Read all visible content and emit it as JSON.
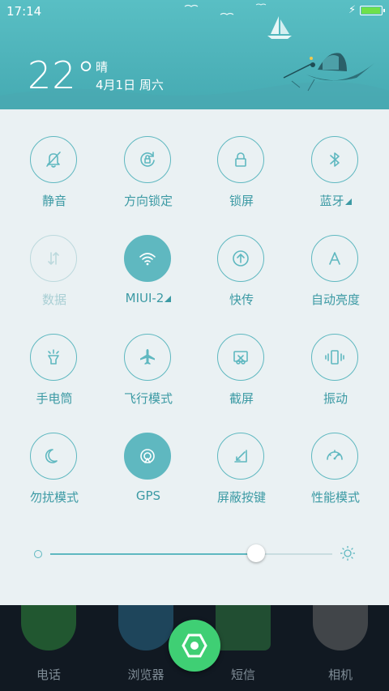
{
  "status_bar": {
    "time": "17:14",
    "battery_level": 1.0
  },
  "weather": {
    "temperature": "22°",
    "condition": "晴",
    "date": "4月1日 周六"
  },
  "toggles": [
    {
      "label": "静音",
      "icon": "bell-off-icon",
      "state": "off"
    },
    {
      "label": "方向锁定",
      "icon": "rotation-lock-icon",
      "state": "off"
    },
    {
      "label": "锁屏",
      "icon": "lock-icon",
      "state": "off"
    },
    {
      "label": "蓝牙",
      "icon": "bluetooth-icon",
      "state": "off",
      "has_submenu": true
    },
    {
      "label": "数据",
      "icon": "data-arrows-icon",
      "state": "disabled"
    },
    {
      "label": "MIUI-2",
      "icon": "wifi-icon",
      "state": "on",
      "has_submenu": true
    },
    {
      "label": "快传",
      "icon": "upload-icon",
      "state": "off"
    },
    {
      "label": "自动亮度",
      "icon": "auto-brightness-icon",
      "state": "off"
    },
    {
      "label": "手电筒",
      "icon": "flashlight-icon",
      "state": "off"
    },
    {
      "label": "飞行模式",
      "icon": "airplane-icon",
      "state": "off"
    },
    {
      "label": "截屏",
      "icon": "screenshot-icon",
      "state": "off"
    },
    {
      "label": "振动",
      "icon": "vibrate-icon",
      "state": "off"
    },
    {
      "label": "勿扰模式",
      "icon": "moon-icon",
      "state": "off"
    },
    {
      "label": "GPS",
      "icon": "gps-icon",
      "state": "on"
    },
    {
      "label": "屏蔽按键",
      "icon": "block-keys-icon",
      "state": "off"
    },
    {
      "label": "性能模式",
      "icon": "speedometer-icon",
      "state": "off"
    }
  ],
  "brightness": {
    "level": 0.73
  },
  "dock": {
    "apps": [
      {
        "label": "电话",
        "icon": "phone-icon",
        "color": "#2f8a3c"
      },
      {
        "label": "浏览器",
        "icon": "browser-icon",
        "color": "#2a6a8a"
      },
      {
        "label": "短信",
        "icon": "message-icon",
        "color": "#2f7a3f"
      },
      {
        "label": "相机",
        "icon": "camera-icon",
        "color": "#6a6a6a"
      }
    ],
    "fab_icon": "hexagon-icon",
    "fab_color": "#3fcf74"
  },
  "colors": {
    "accent": "#5fb8c0",
    "label": "#3c9aa4",
    "header": "#4eb3ba",
    "panel": "#eaf1f3"
  }
}
